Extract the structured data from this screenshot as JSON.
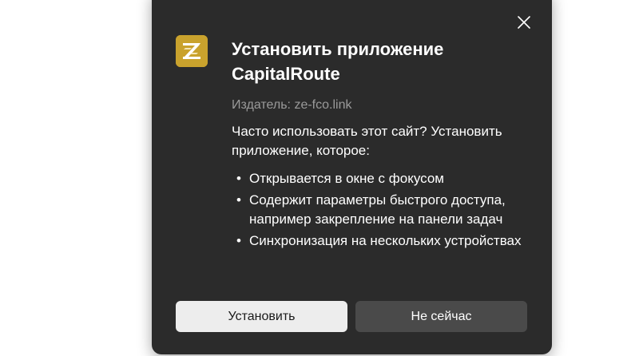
{
  "dialog": {
    "app_icon": "capitalroute-logo-icon",
    "close_icon": "close-icon",
    "title": "Установить приложение CapitalRoute",
    "publisher": "Издатель: ze-fco.link",
    "description": "Часто использовать этот сайт? Установить приложение, которое:",
    "features": [
      "Открывается в окне с фокусом",
      "Содержит параметры быстрого доступа, например закрепление на панели задач",
      "Синхронизация на нескольких устройствах"
    ],
    "bullet": "•",
    "install_label": "Установить",
    "not_now_label": "Не сейчас"
  },
  "colors": {
    "dialog_background": "#2b2b2b",
    "icon_background": "#c9a22d",
    "primary_button": "#ededed",
    "secondary_button": "#4a4a4a",
    "muted_text": "#9a9a9a"
  }
}
